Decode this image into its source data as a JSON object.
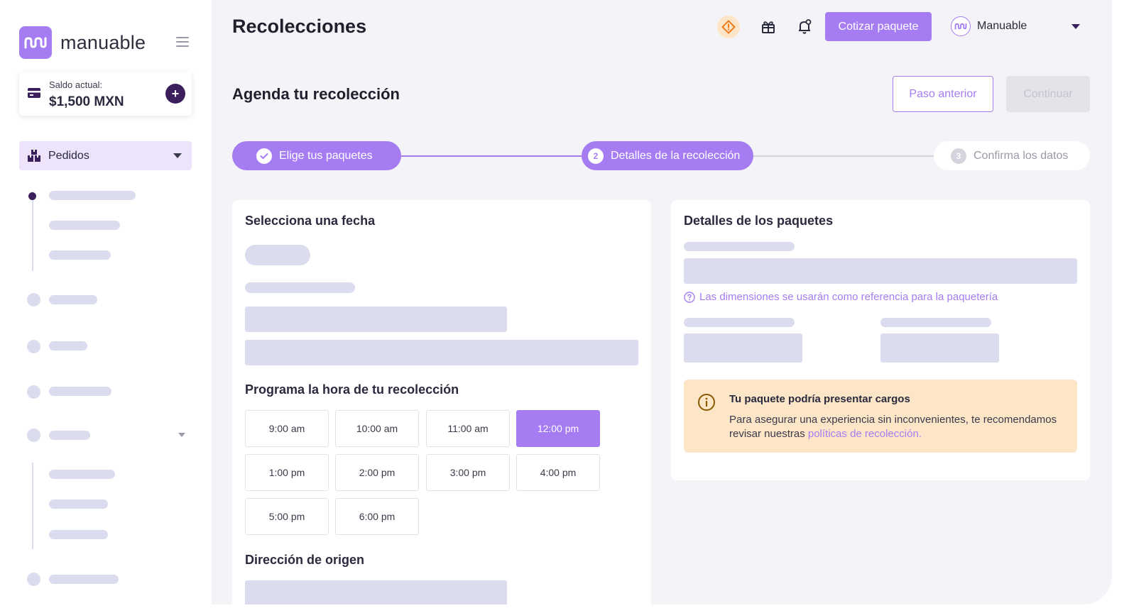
{
  "brand": {
    "name": "manuable",
    "accent": "#a57cf2",
    "dark": "#3a1f5c"
  },
  "sidebar": {
    "balance_label": "Saldo actual:",
    "balance_value": "$1,500 MXN",
    "active_item": {
      "label": "Pedidos",
      "icon": "boxes-icon"
    }
  },
  "header": {
    "title": "Recolecciones",
    "icons": [
      "warning-icon",
      "gift-icon",
      "bell-icon"
    ],
    "primary_button": "Cotizar paquete",
    "user_name": "Manuable"
  },
  "section": {
    "title": "Agenda tu recolección",
    "back_button": "Paso anterior",
    "continue_button": "Continuar"
  },
  "stepper": {
    "steps": [
      {
        "label": "Elige tus paquetes",
        "state": "done"
      },
      {
        "number": "2",
        "label": "Detalles de la recolección",
        "state": "current"
      },
      {
        "number": "3",
        "label": "Confirma los datos",
        "state": "pending"
      }
    ]
  },
  "left_card": {
    "date_title": "Selecciona una fecha",
    "time_title": "Programa la hora de tu recolección",
    "times": [
      "9:00 am",
      "10:00 am",
      "11:00 am",
      "12:00 pm",
      "1:00 pm",
      "2:00 pm",
      "3:00 pm",
      "4:00 pm",
      "5:00 pm",
      "6:00 pm"
    ],
    "selected_time": "12:00 pm",
    "origin_title": "Dirección de origen"
  },
  "right_card": {
    "title": "Detalles de los paquetes",
    "hint": "Las dimensiones se usarán como referencia para la paquetería",
    "alert": {
      "title": "Tu paquete podría presentar cargos",
      "body": "Para asegurar una experiencia sin inconvenientes, te recomendamos revisar nuestras ",
      "link": "políticas de recolección."
    }
  }
}
